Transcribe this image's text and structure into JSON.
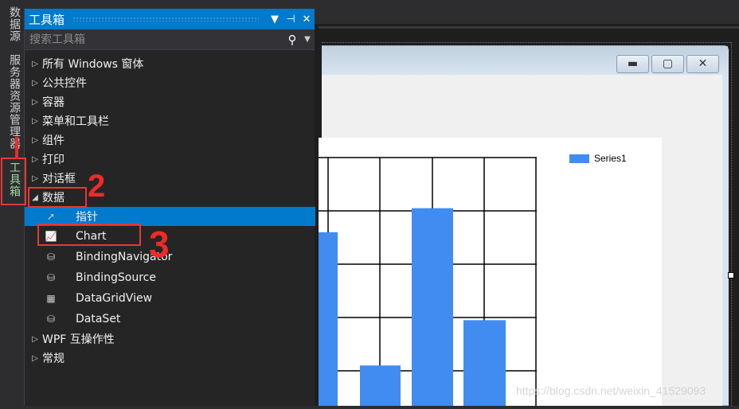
{
  "side_tabs": [
    "数据源",
    "服务器资源管理器",
    "工具箱"
  ],
  "toolbox": {
    "title": "工具箱",
    "search_placeholder": "搜索工具箱",
    "groups_before": [
      "所有 Windows 窗体",
      "公共控件",
      "容器",
      "菜单和工具栏",
      "组件",
      "打印",
      "对话框"
    ],
    "expanded_group": "数据",
    "items": [
      {
        "label": "指针",
        "icon": "pointer-icon",
        "selected": true
      },
      {
        "label": "Chart",
        "icon": "chart-icon"
      },
      {
        "label": "BindingNavigator",
        "icon": "binding-navigator-icon"
      },
      {
        "label": "BindingSource",
        "icon": "binding-source-icon"
      },
      {
        "label": "DataGridView",
        "icon": "datagridview-icon"
      },
      {
        "label": "DataSet",
        "icon": "dataset-icon"
      }
    ],
    "groups_after": [
      "WPF 互操作性",
      "常规"
    ]
  },
  "chart": {
    "legend": "Series1",
    "series_color": "#418cf0",
    "bar_levels_in_gridlines": [
      2.6,
      0.1,
      3.05,
      0.95
    ]
  },
  "annotations": [
    "1",
    "2",
    "3"
  ],
  "watermark": "https://blog.csdn.net/weixin_41529093"
}
